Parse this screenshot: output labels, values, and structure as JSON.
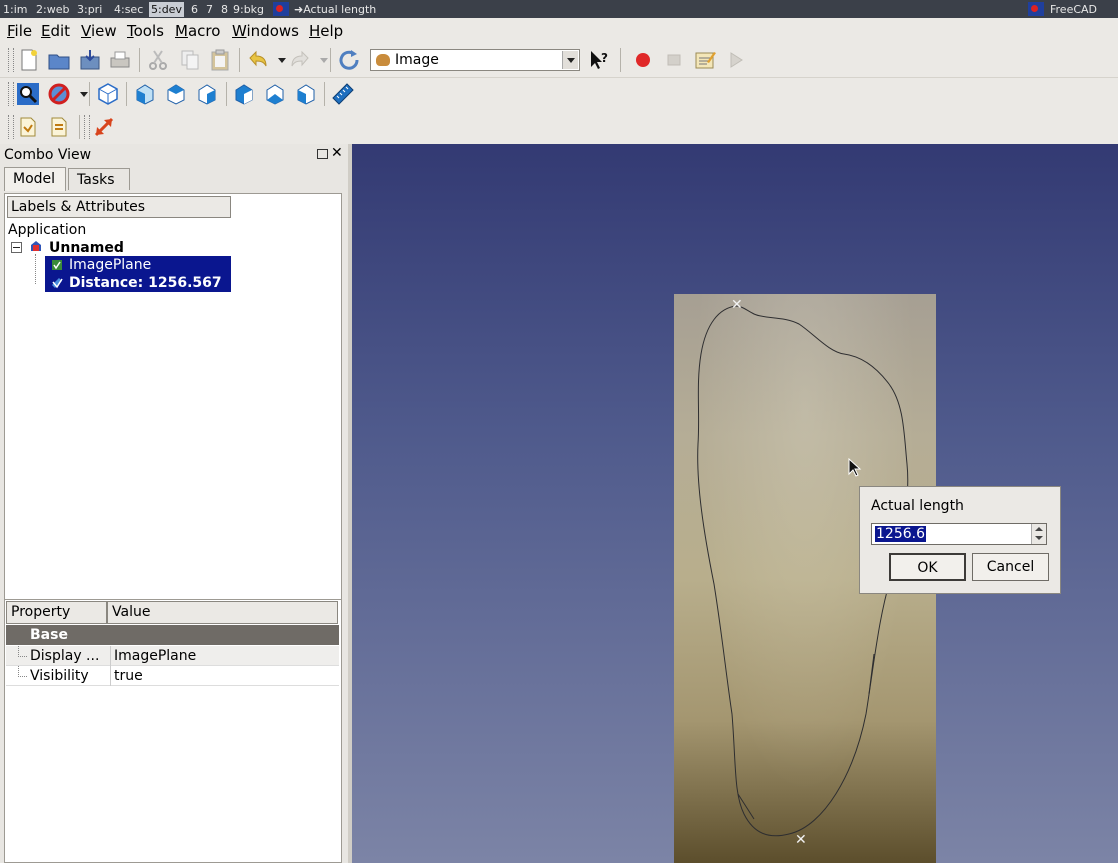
{
  "taskbar": {
    "workspaces": [
      "1:im",
      "2:web",
      "3:pri",
      "4:sec",
      "5:dev",
      "6",
      "7",
      "8",
      "9:bkg"
    ],
    "active_workspace": "5:dev",
    "window_title": "Actual length",
    "app_name": "FreeCAD"
  },
  "menubar": {
    "items": [
      "File",
      "Edit",
      "View",
      "Tools",
      "Macro",
      "Windows",
      "Help"
    ]
  },
  "toolbar": {
    "workbench": "Image",
    "icons": [
      "new-file-icon",
      "open-file-icon",
      "save-icon",
      "print-icon",
      "cut-icon",
      "copy-icon",
      "paste-icon",
      "undo-icon",
      "redo-icon",
      "refresh-icon",
      "whats-this-icon",
      "record-macro-icon",
      "stop-macro-icon",
      "edit-macro-icon",
      "run-macro-icon"
    ]
  },
  "view_toolbar": {
    "icons": [
      "fit-all-icon",
      "draw-style-icon",
      "isometric-view-icon",
      "front-view-icon",
      "top-view-icon",
      "right-view-icon",
      "rear-view-icon",
      "bottom-view-icon",
      "left-view-icon",
      "measure-distance-icon"
    ]
  },
  "image_toolbar": {
    "icons": [
      "open-image-icon",
      "create-image-plane-icon",
      "scale-image-icon"
    ]
  },
  "combo_view": {
    "title": "Combo View",
    "tabs": [
      "Model",
      "Tasks"
    ],
    "active_tab": "Model",
    "tree": {
      "header": "Labels & Attributes",
      "root": "Application",
      "document": "Unnamed",
      "items": [
        {
          "label": "ImagePlane",
          "selected": true
        },
        {
          "label": "Distance: 1256.567",
          "selected": true
        }
      ]
    },
    "properties": {
      "headers": [
        "Property",
        "Value"
      ],
      "group": "Base",
      "rows": [
        {
          "name": "Display ...",
          "value": "ImagePlane"
        },
        {
          "name": "Visibility",
          "value": "true"
        }
      ]
    }
  },
  "dialog": {
    "label": "Actual length",
    "value": "1256.6",
    "ok": "OK",
    "cancel": "Cancel"
  },
  "colors": {
    "selection": "#0a168f",
    "view_top": "#333a73",
    "view_bottom": "#7c84a6"
  }
}
